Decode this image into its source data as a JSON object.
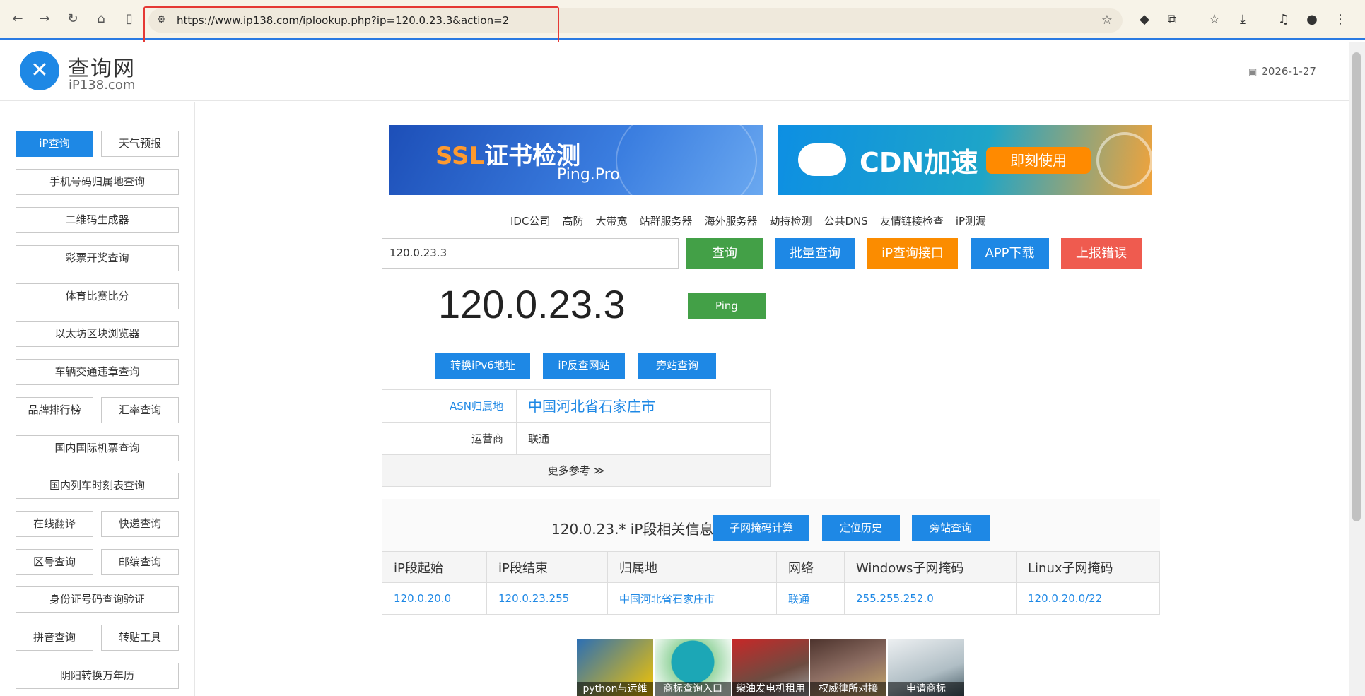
{
  "browser": {
    "url": "https://www.ip138.com/iplookup.php?ip=120.0.23.3&action=2",
    "nav_icons": [
      "back-icon",
      "forward-icon",
      "reload-icon",
      "home-icon",
      "reader-icon"
    ],
    "ext_icons": [
      "extension-icon",
      "puzzle-icon",
      "bookmarks-icon",
      "download-icon",
      "media-icon",
      "profile-icon",
      "more-icon"
    ]
  },
  "header": {
    "logo_title": "查询网",
    "logo_sub": "iP138.com",
    "date": "2026-1-27"
  },
  "sidebar": {
    "ip_lookup": "iP查询",
    "weather": "天气预报",
    "phone": "手机号码归属地查询",
    "qrcode": "二维码生成器",
    "lottery": "彩票开奖查询",
    "sports": "体育比赛比分",
    "ethereum": "以太坊区块浏览器",
    "traffic": "车辆交通违章查询",
    "brand": "品牌排行榜",
    "exchange": "汇率查询",
    "flight": "国内国际机票查询",
    "train": "国内列车时刻表查询",
    "translate": "在线翻译",
    "express": "快递查询",
    "areacode": "区号查询",
    "postcode": "邮编查询",
    "idcard": "身份证号码查询验证",
    "pinyin": "拼音查询",
    "paste": "转贴工具",
    "calendar": "阴阳转换万年历"
  },
  "banners": {
    "ssl_prefix": "SSL",
    "ssl_title": "证书检测",
    "ssl_sub": "Ping.Pro",
    "cdn_title": "CDN加速",
    "cdn_btn": "即刻使用"
  },
  "quick_links": [
    "IDC公司",
    "高防",
    "大带宽",
    "站群服务器",
    "海外服务器",
    "劫持检测",
    "公共DNS",
    "友情链接检查",
    "iP测漏"
  ],
  "search": {
    "value": "120.0.23.3",
    "query_btn": "查询",
    "batch_btn": "批量查询",
    "api_btn": "iP查询接口",
    "app_btn": "APP下载",
    "report_btn": "上报错误"
  },
  "result": {
    "ip": "120.0.23.3",
    "ping_btn": "Ping",
    "ipv6_btn": "转换iPv6地址",
    "reverse_btn": "iP反查网站",
    "sibling_btn": "旁站查询",
    "asn_label": "ASN归属地",
    "asn_value": "中国河北省石家庄市",
    "isp_label": "运营商",
    "isp_value": "联通",
    "more": "更多参考 ≫"
  },
  "segment": {
    "title": "120.0.23.* iP段相关信息",
    "subnet_btn": "子网掩码计算",
    "history_btn": "定位历史",
    "sibling_btn": "旁站查询",
    "columns": [
      "iP段起始",
      "iP段结束",
      "归属地",
      "网络",
      "Windows子网掩码",
      "Linux子网掩码"
    ],
    "row": [
      "120.0.20.0",
      "120.0.23.255",
      "中国河北省石家庄市",
      "联通",
      "255.255.252.0",
      "120.0.20.0/22"
    ]
  },
  "thumbnails": [
    "python与运维",
    "商标查询入口",
    "柴油发电机租用",
    "权威律所对接",
    "申请商标"
  ],
  "colors": {
    "accent_blue": "#1e88e5",
    "green": "#43a047",
    "orange": "#fb8c00",
    "red": "#ef5b4f"
  }
}
